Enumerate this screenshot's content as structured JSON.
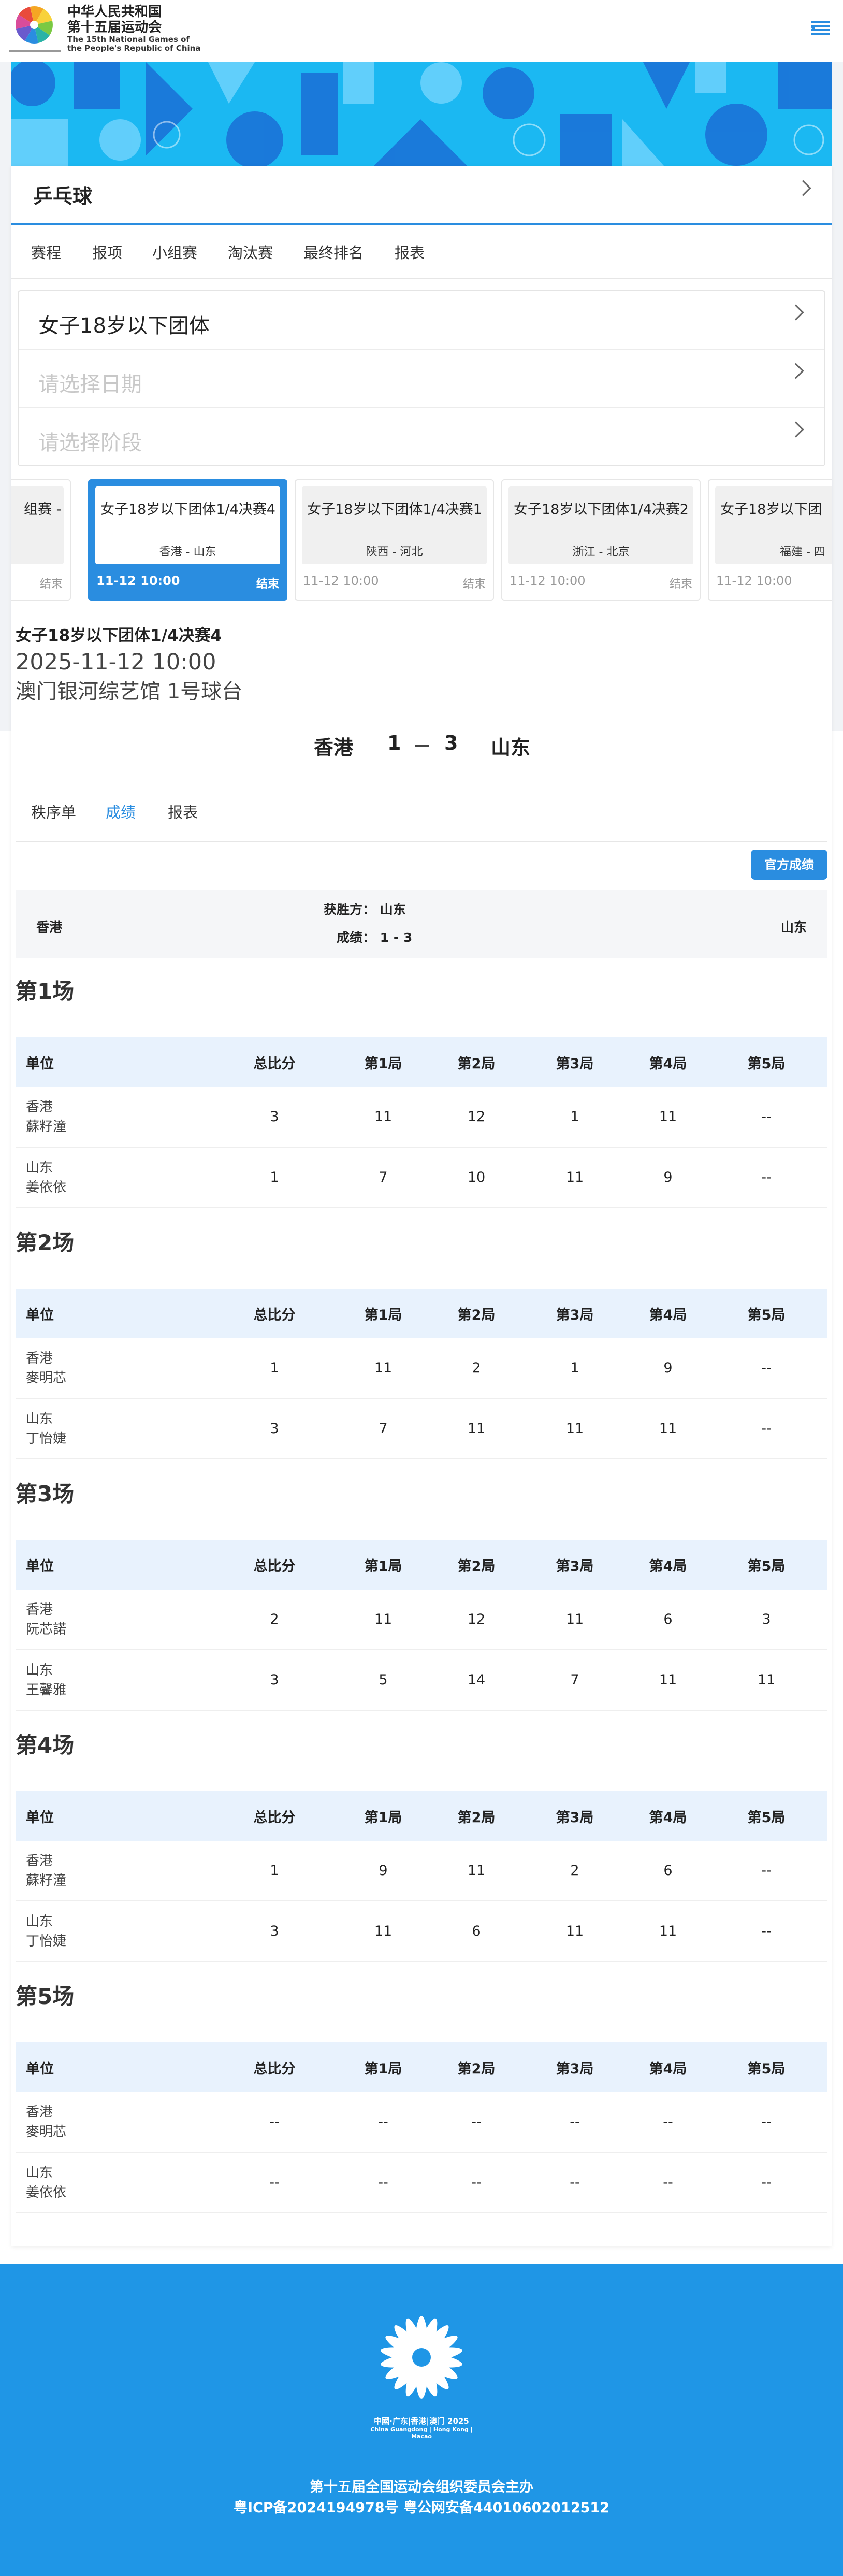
{
  "header": {
    "logo_cn_1": "中华人民共和国",
    "logo_cn_2": "第十五届运动会",
    "logo_en_1": "The 15th National Games of",
    "logo_en_2": "the People's Republic of China"
  },
  "sport": {
    "title": "乒乓球"
  },
  "nav_tabs": [
    "赛程",
    "报项",
    "小组赛",
    "淘汰赛",
    "最终排名",
    "报表"
  ],
  "selectors": {
    "event": "女子18岁以下团体",
    "date_placeholder": "请选择日期",
    "stage_placeholder": "请选择阶段"
  },
  "match_cards": [
    {
      "title": "组赛 -",
      "teams": "",
      "time": "",
      "status": "结束"
    },
    {
      "title": "女子18岁以下团体1/4决赛4",
      "teams": "香港 - 山东",
      "time": "11-12 10:00",
      "status": "结束"
    },
    {
      "title": "女子18岁以下团体1/4决赛1",
      "teams": "陕西 - 河北",
      "time": "11-12 10:00",
      "status": "结束"
    },
    {
      "title": "女子18岁以下团体1/4决赛2",
      "teams": "浙江 - 北京",
      "time": "11-12 10:00",
      "status": "结束"
    },
    {
      "title": "女子18岁以下团",
      "teams": "福建 - 四",
      "time": "11-12 10:00",
      "status": ""
    }
  ],
  "match": {
    "name": "女子18岁以下团体1/4决赛4",
    "datetime": "2025-11-12 10:00",
    "venue": "澳门银河综艺馆 1号球台",
    "home": "香港",
    "home_score": "1",
    "away_score": "3",
    "away": "山东"
  },
  "subtabs": [
    "秩序单",
    "成绩",
    "报表"
  ],
  "official_button": "官方成绩",
  "summary": {
    "left_team": "香港",
    "right_team": "山东",
    "winner_label": "获胜方：",
    "winner": "山东",
    "result_label": "成绩：",
    "result": "1 - 3"
  },
  "table_headers": [
    "单位",
    "总比分",
    "第1局",
    "第2局",
    "第3局",
    "第4局",
    "第5局"
  ],
  "games": [
    {
      "title": "第1场",
      "rows": [
        {
          "team": "香港",
          "player": "蘇籽潼",
          "cells": [
            "3",
            "11",
            "12",
            "1",
            "11",
            "--"
          ]
        },
        {
          "team": "山东",
          "player": "姜依依",
          "cells": [
            "1",
            "7",
            "10",
            "11",
            "9",
            "--"
          ]
        }
      ]
    },
    {
      "title": "第2场",
      "rows": [
        {
          "team": "香港",
          "player": "麥明芯",
          "cells": [
            "1",
            "11",
            "2",
            "1",
            "9",
            "--"
          ]
        },
        {
          "team": "山东",
          "player": "丁怡婕",
          "cells": [
            "3",
            "7",
            "11",
            "11",
            "11",
            "--"
          ]
        }
      ]
    },
    {
      "title": "第3场",
      "rows": [
        {
          "team": "香港",
          "player": "阮芯諾",
          "cells": [
            "2",
            "11",
            "12",
            "11",
            "6",
            "3"
          ]
        },
        {
          "team": "山东",
          "player": "王馨雅",
          "cells": [
            "3",
            "5",
            "14",
            "7",
            "11",
            "11"
          ]
        }
      ]
    },
    {
      "title": "第4场",
      "rows": [
        {
          "team": "香港",
          "player": "蘇籽潼",
          "cells": [
            "1",
            "9",
            "11",
            "2",
            "6",
            "--"
          ]
        },
        {
          "team": "山东",
          "player": "丁怡婕",
          "cells": [
            "3",
            "11",
            "6",
            "11",
            "11",
            "--"
          ]
        }
      ]
    },
    {
      "title": "第5场",
      "rows": [
        {
          "team": "香港",
          "player": "麥明芯",
          "cells": [
            "--",
            "--",
            "--",
            "--",
            "--",
            "--"
          ]
        },
        {
          "team": "山东",
          "player": "姜依依",
          "cells": [
            "--",
            "--",
            "--",
            "--",
            "--",
            "--"
          ]
        }
      ]
    }
  ],
  "footer": {
    "logo_text": "中國·广东|香港|澳门 2025",
    "logo_subtext": "China Guangdong | Hong Kong | Macao",
    "line1": "第十五届全国运动会组织委员会主办",
    "line2": "粤ICP备2024194978号  粤公网安备44010602012512"
  },
  "colors": {
    "accent": "#2a8de0",
    "banner": "#12b7f5",
    "footer": "#1f96e6"
  }
}
